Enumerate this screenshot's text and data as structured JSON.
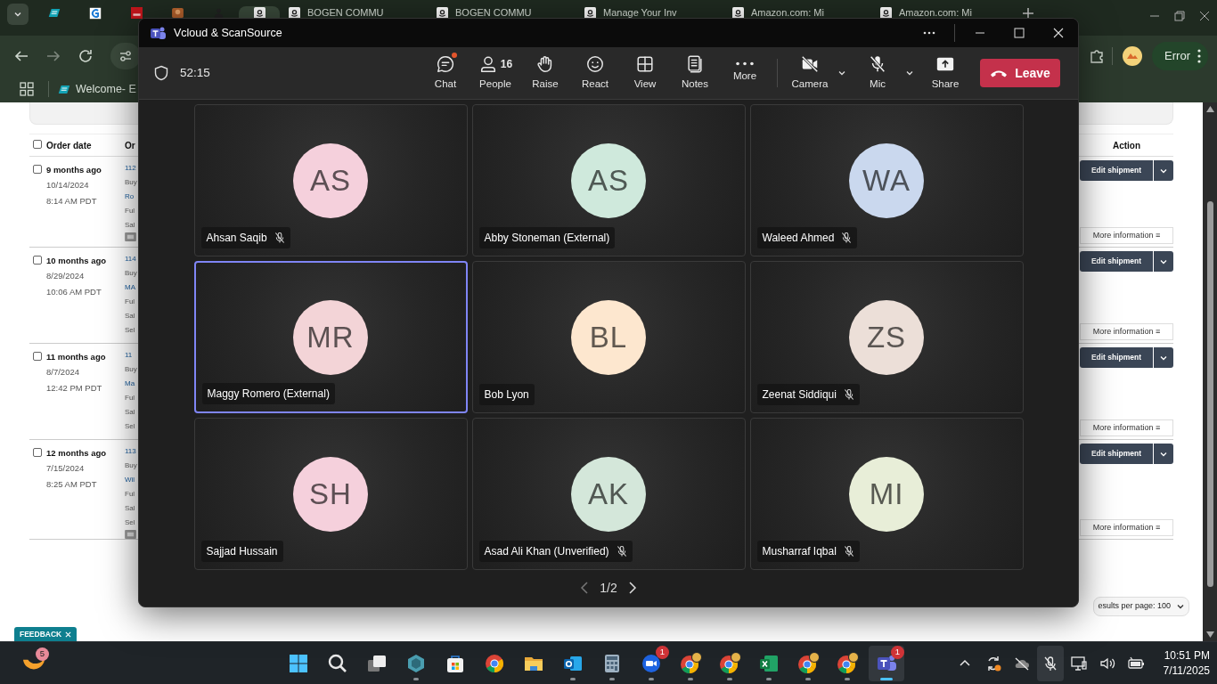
{
  "browser": {
    "tabs": [
      {
        "kind": "ec",
        "selected": false
      },
      {
        "kind": "g",
        "selected": false
      },
      {
        "kind": "dw",
        "selected": false
      },
      {
        "kind": "pic",
        "selected": false
      },
      {
        "kind": "person",
        "selected": false
      },
      {
        "kind": "amazon",
        "selected": true
      },
      {
        "kind": "amazon",
        "label": "BOGEN COMMU",
        "selected": false
      },
      {
        "kind": "amazon",
        "label": "BOGEN COMMU",
        "selected": false
      },
      {
        "kind": "amazon",
        "label": "Manage Your Inv",
        "selected": false
      },
      {
        "kind": "amazon",
        "label": "Amazon.com: Mi",
        "selected": false
      },
      {
        "kind": "amazon",
        "label": "Amazon.com: Mi",
        "selected": false
      }
    ],
    "bookmarks": [
      {
        "label": "Welcome- E"
      }
    ],
    "profile_status": "Error"
  },
  "page": {
    "header": {
      "checked": false,
      "order_date": "Order date",
      "order_column": "Or",
      "action": "Action"
    },
    "orders": [
      {
        "checked": false,
        "age": "9 months ago",
        "date": "10/14/2024",
        "time": "8:14 AM PDT",
        "fragments": [
          "112",
          "Buy",
          "Ro",
          "Ful",
          "Sal"
        ],
        "tag": true,
        "edit": "Edit shipment",
        "more": "More information ≡"
      },
      {
        "checked": false,
        "age": "10 months ago",
        "date": "8/29/2024",
        "time": "10:06 AM PDT",
        "fragments": [
          "114",
          "Buy",
          "MA",
          "Ful",
          "Sal",
          "Sel"
        ],
        "tag": false,
        "edit": "Edit shipment",
        "more": "More information ≡"
      },
      {
        "checked": false,
        "age": "11 months ago",
        "date": "8/7/2024",
        "time": "12:42 PM PDT",
        "fragments": [
          "11",
          "Buy",
          "Ma",
          "Ful",
          "Sal",
          "Sel"
        ],
        "tag": false,
        "edit": "Edit shipment",
        "more": "More information ≡"
      },
      {
        "checked": false,
        "age": "12 months ago",
        "date": "7/15/2024",
        "time": "8:25 AM PDT",
        "fragments": [
          "113",
          "Buy",
          "Wil",
          "Ful",
          "Sal",
          "Sel"
        ],
        "tag": true,
        "edit": "Edit shipment",
        "more": "More information ≡"
      }
    ],
    "results_per_page": "esults per page: 100",
    "feedback": "FEEDBACK"
  },
  "teams": {
    "title": "Vcloud & ScanSource",
    "timer": "52:15",
    "toolbar": [
      {
        "kind": "chat",
        "label": "Chat",
        "unread": true
      },
      {
        "kind": "people",
        "label": "People",
        "count": "16"
      },
      {
        "kind": "raise",
        "label": "Raise"
      },
      {
        "kind": "react",
        "label": "React"
      },
      {
        "kind": "view",
        "label": "View"
      },
      {
        "kind": "notes",
        "label": "Notes"
      },
      {
        "kind": "more",
        "label": "More"
      },
      {
        "kind": "camera",
        "label": "Camera",
        "on": false
      },
      {
        "kind": "mic",
        "label": "Mic",
        "on": false
      },
      {
        "kind": "share",
        "label": "Share"
      }
    ],
    "leave": "Leave",
    "participants": [
      {
        "initials": "AS",
        "name": "Ahsan Saqib",
        "color": "#f5d0dc",
        "muted": true,
        "speaking": false
      },
      {
        "initials": "AS",
        "name": "Abby Stoneman (External)",
        "color": "#cfe9dc",
        "muted": false,
        "speaking": false
      },
      {
        "initials": "WA",
        "name": "Waleed Ahmed",
        "color": "#cad8ee",
        "muted": true,
        "speaking": false
      },
      {
        "initials": "MR",
        "name": "Maggy Romero (External)",
        "color": "#f3d4d7",
        "muted": false,
        "speaking": true
      },
      {
        "initials": "BL",
        "name": "Bob Lyon",
        "color": "#fde7cf",
        "muted": false,
        "speaking": false
      },
      {
        "initials": "ZS",
        "name": "Zeenat Siddiqui",
        "color": "#ecdfd8",
        "muted": true,
        "speaking": false
      },
      {
        "initials": "SH",
        "name": "Sajjad Hussain",
        "color": "#f5d0dc",
        "muted": false,
        "speaking": false
      },
      {
        "initials": "AK",
        "name": "Asad Ali Khan (Unverified)",
        "color": "#d4e7da",
        "muted": true,
        "speaking": false
      },
      {
        "initials": "MI",
        "name": "Musharraf Iqbal",
        "color": "#e8eed8",
        "muted": true,
        "speaking": false
      }
    ],
    "pager": "1/2"
  },
  "taskbar": {
    "weather_badge": "5",
    "apps": [
      {
        "kind": "start",
        "open": false,
        "active": false
      },
      {
        "kind": "search",
        "open": false,
        "active": false
      },
      {
        "kind": "taskview",
        "open": false,
        "active": false
      },
      {
        "kind": "diamond",
        "open": true,
        "active": false
      },
      {
        "kind": "store",
        "open": false,
        "active": false
      },
      {
        "kind": "chrome",
        "open": false,
        "active": false
      },
      {
        "kind": "folder",
        "open": false,
        "active": false
      },
      {
        "kind": "outlook",
        "open": true,
        "active": false
      },
      {
        "kind": "calculator",
        "open": true,
        "active": false
      },
      {
        "kind": "zoom",
        "open": true,
        "active": false,
        "badge": "1"
      },
      {
        "kind": "chrome-profile",
        "open": true,
        "active": false
      },
      {
        "kind": "chrome-profile",
        "open": true,
        "active": false
      },
      {
        "kind": "excel",
        "open": true,
        "active": false
      },
      {
        "kind": "chrome-profile",
        "open": true,
        "active": false
      },
      {
        "kind": "chrome-profile",
        "open": true,
        "active": false
      },
      {
        "kind": "teams",
        "open": true,
        "active": true,
        "badge": "1"
      }
    ],
    "tray": [
      {
        "kind": "chevron",
        "highlighted": false
      },
      {
        "kind": "sync",
        "highlighted": false
      },
      {
        "kind": "cloud",
        "highlighted": false
      },
      {
        "kind": "mic-off",
        "highlighted": true
      },
      {
        "kind": "network",
        "highlighted": false
      },
      {
        "kind": "volume",
        "highlighted": false
      },
      {
        "kind": "battery",
        "highlighted": false
      }
    ],
    "time": "10:51 PM",
    "date": "7/11/2025"
  }
}
